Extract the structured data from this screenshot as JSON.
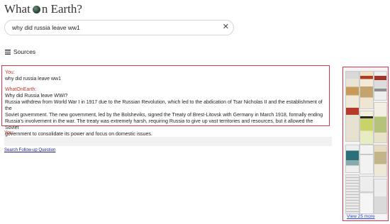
{
  "app": {
    "title_part1": "What",
    "title_part2": "n Earth?"
  },
  "search": {
    "value": "why did russia leave ww1",
    "clear_symbol": "✕"
  },
  "sources": {
    "label": "Sources"
  },
  "conversation": {
    "user_label": "You:",
    "user_text": "why did russia leave ww1",
    "assistant_label": "WhatOnEarth:",
    "assistant_question": "Why did Russia leave WWI?",
    "assistant_lines": [
      "Russia withdrew from World War I in 1917 due to the Russian Revolution, which led to the abdication of Tsar Nicholas II and the establishment of the",
      "Soviet government. The new government, led by the Bolsheviks, signed the Treaty of Brest-Litovsk with Germany in March 1918, formally ending",
      "Russia's involvement in the war. The treaty was extremely harsh, requiring Russia to give up vast territories and resources, but it allowed the Soviet",
      "government to consolidate its power and focus on domestic issues."
    ]
  },
  "followup": {
    "you_label": "You:",
    "link": "Search Follow-up Question"
  },
  "panel": {
    "view_more": "View 25 more"
  },
  "colors": {
    "accent": "#d23a4c",
    "label_red": "#c0392b",
    "link_blue": "#2b4fc7"
  }
}
